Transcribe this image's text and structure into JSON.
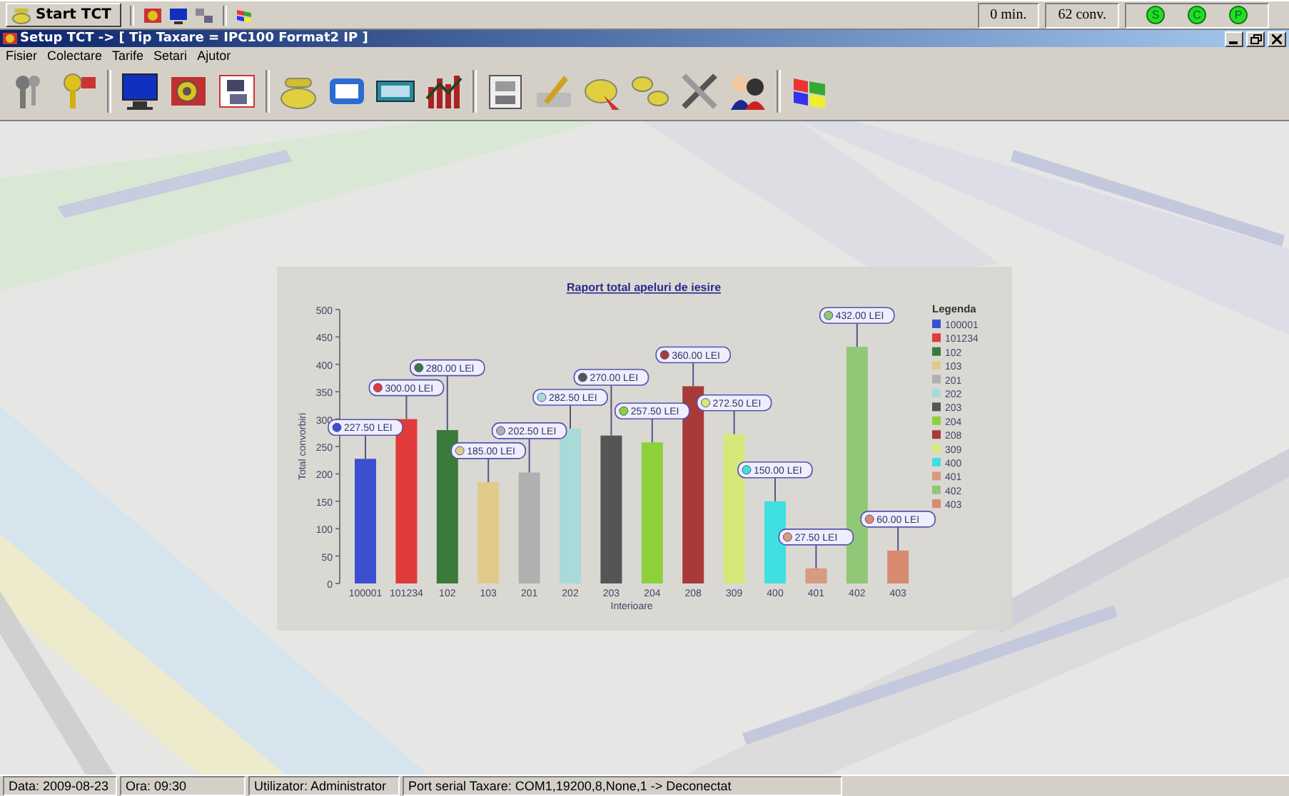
{
  "taskbar": {
    "start_button": "Start TCT",
    "minutes": "0 min.",
    "conversations": "62 conv.",
    "indicators": [
      "S",
      "C",
      "P"
    ]
  },
  "window": {
    "title": "Setup TCT -> [ Tip Taxare = IPC100 Format2 IP ]"
  },
  "menu": [
    "Fisier",
    "Colectare",
    "Tarife",
    "Setari",
    "Ajutor"
  ],
  "chart": {
    "chart_data": {
      "type": "bar",
      "title": "Raport total apeluri de iesire",
      "xlabel": "Interioare",
      "ylabel": "Total convorbiri",
      "categories": [
        "100001",
        "101234",
        "102",
        "103",
        "201",
        "202",
        "203",
        "204",
        "208",
        "309",
        "400",
        "401",
        "402",
        "403"
      ],
      "series": [
        {
          "values": [
            227.5,
            300,
            280,
            185,
            202.5,
            282.5,
            270,
            257.5,
            360,
            272.5,
            150,
            27.5,
            432,
            60
          ]
        }
      ],
      "ylim": [
        0,
        500
      ],
      "yticks": [
        0,
        50,
        100,
        150,
        200,
        250,
        300,
        350,
        400,
        450,
        500
      ],
      "value_labels": [
        "227.50 LEI",
        "300.00 LEI",
        "280.00 LEI",
        "185.00 LEI",
        "202.50 LEI",
        "282.50 LEI",
        "270.00 LEI",
        "257.50 LEI",
        "360.00 LEI",
        "272.50 LEI",
        "150.00 LEI",
        "27.50 LEI",
        "432.00 LEI",
        "60.00 LEI"
      ]
    },
    "legend": {
      "title": "Legenda",
      "items": [
        {
          "label": "100001",
          "color": "#3b4fd0"
        },
        {
          "label": "101234",
          "color": "#e03a3a"
        },
        {
          "label": "102",
          "color": "#3a7a3a"
        },
        {
          "label": "103",
          "color": "#e0cc88"
        },
        {
          "label": "201",
          "color": "#b0b0b0"
        },
        {
          "label": "202",
          "color": "#a8dada"
        },
        {
          "label": "203",
          "color": "#555555"
        },
        {
          "label": "204",
          "color": "#8cd13a"
        },
        {
          "label": "208",
          "color": "#a83a3a"
        },
        {
          "label": "309",
          "color": "#d6e87a"
        },
        {
          "label": "400",
          "color": "#40e0e0"
        },
        {
          "label": "401",
          "color": "#d89a80"
        },
        {
          "label": "402",
          "color": "#90c878"
        },
        {
          "label": "403",
          "color": "#d88a70"
        }
      ]
    }
  },
  "status_bar": [
    "Data: 2009-08-23",
    "Ora: 09:30",
    "Utilizator: Administrator",
    "Port serial Taxare: COM1,19200,8,None,1 -> Deconectat"
  ]
}
